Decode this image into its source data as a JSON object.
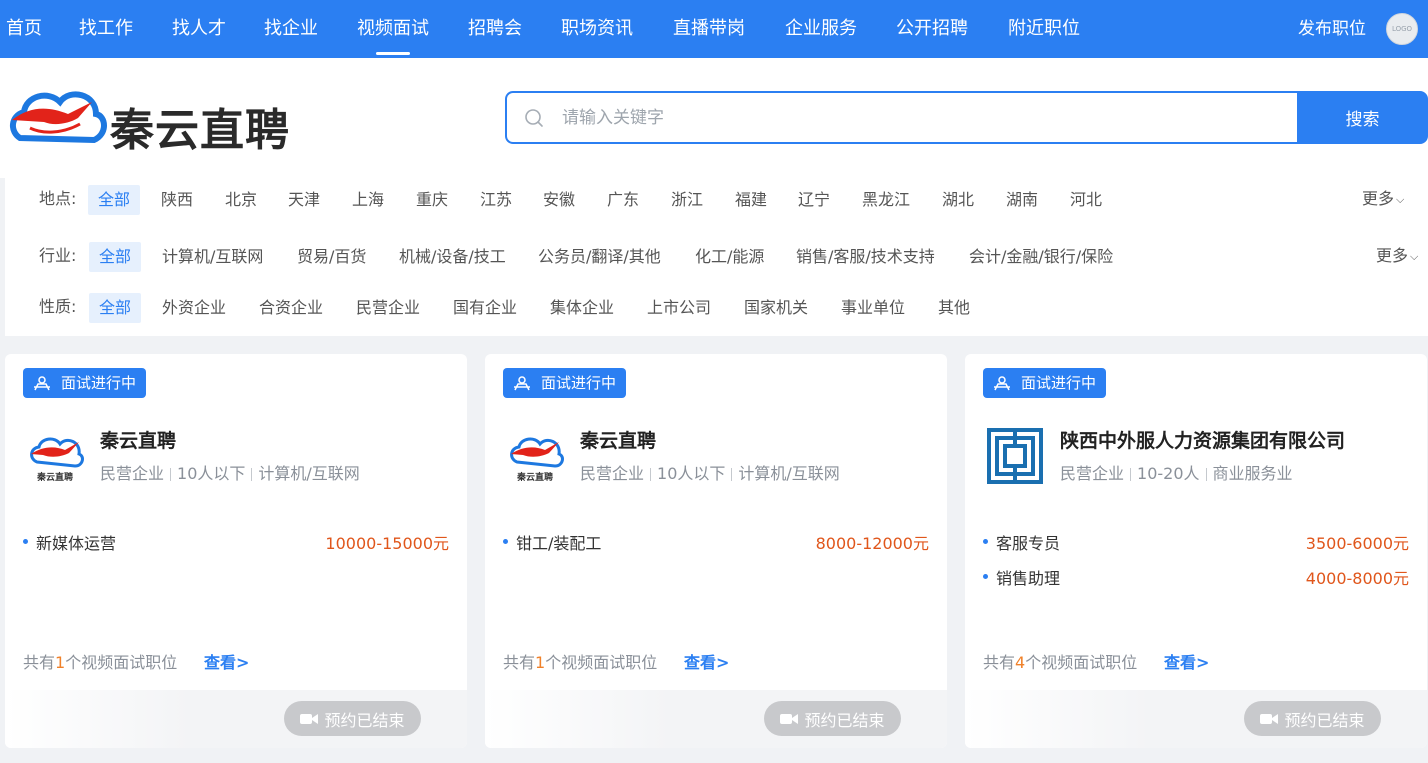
{
  "nav": {
    "items": [
      "首页",
      "找工作",
      "找人才",
      "找企业",
      "视频面试",
      "招聘会",
      "职场资讯",
      "直播带岗",
      "企业服务",
      "公开招聘",
      "附近职位"
    ],
    "active_index": 4,
    "publish_label": "发布职位",
    "avatar_text": "LOGO"
  },
  "header": {
    "logo_text": "秦云直聘",
    "search_placeholder": "请输入关键字",
    "search_button": "搜索"
  },
  "filters": {
    "location": {
      "label": "地点:",
      "options": [
        "全部",
        "陕西",
        "北京",
        "天津",
        "上海",
        "重庆",
        "江苏",
        "安徽",
        "广东",
        "浙江",
        "福建",
        "辽宁",
        "黑龙江",
        "湖北",
        "湖南",
        "河北"
      ],
      "more": "更多"
    },
    "industry": {
      "label": "行业:",
      "options": [
        "全部",
        "计算机/互联网",
        "贸易/百货",
        "机械/设备/技工",
        "公务员/翻译/其他",
        "化工/能源",
        "销售/客服/技术支持",
        "会计/金融/银行/保险"
      ],
      "more": "更多"
    },
    "nature": {
      "label": "性质:",
      "options": [
        "全部",
        "外资企业",
        "合资企业",
        "民营企业",
        "国有企业",
        "集体企业",
        "上市公司",
        "国家机关",
        "事业单位",
        "其他"
      ]
    }
  },
  "cards": [
    {
      "badge": "面试进行中",
      "logo_text": "秦云直聘",
      "company": "秦云直聘",
      "meta": [
        "民营企业",
        "10人以下",
        "计算机/互联网"
      ],
      "jobs": [
        {
          "title": "新媒体运营",
          "salary": "10000-15000元"
        }
      ],
      "count_prefix": "共有",
      "count": "1",
      "count_suffix": "个视频面试职位",
      "view": "查看>",
      "end_label": "预约已结束"
    },
    {
      "badge": "面试进行中",
      "logo_text": "秦云直聘",
      "company": "秦云直聘",
      "meta": [
        "民营企业",
        "10人以下",
        "计算机/互联网"
      ],
      "jobs": [
        {
          "title": "钳工/装配工",
          "salary": "8000-12000元"
        }
      ],
      "count_prefix": "共有",
      "count": "1",
      "count_suffix": "个视频面试职位",
      "view": "查看>",
      "end_label": "预约已结束"
    },
    {
      "badge": "面试进行中",
      "company": "陕西中外服人力资源集团有限公司",
      "meta": [
        "民营企业",
        "10-20人",
        "商业服务业"
      ],
      "jobs": [
        {
          "title": "客服专员",
          "salary": "3500-6000元"
        },
        {
          "title": "销售助理",
          "salary": "4000-8000元"
        }
      ],
      "count_prefix": "共有",
      "count": "4",
      "count_suffix": "个视频面试职位",
      "view": "查看>",
      "end_label": "预约已结束"
    }
  ],
  "colors": {
    "primary": "#2b7ff2",
    "salary": "#e0561b",
    "count_highlight": "#f0812a",
    "ended_button": "#c8c9cc"
  }
}
